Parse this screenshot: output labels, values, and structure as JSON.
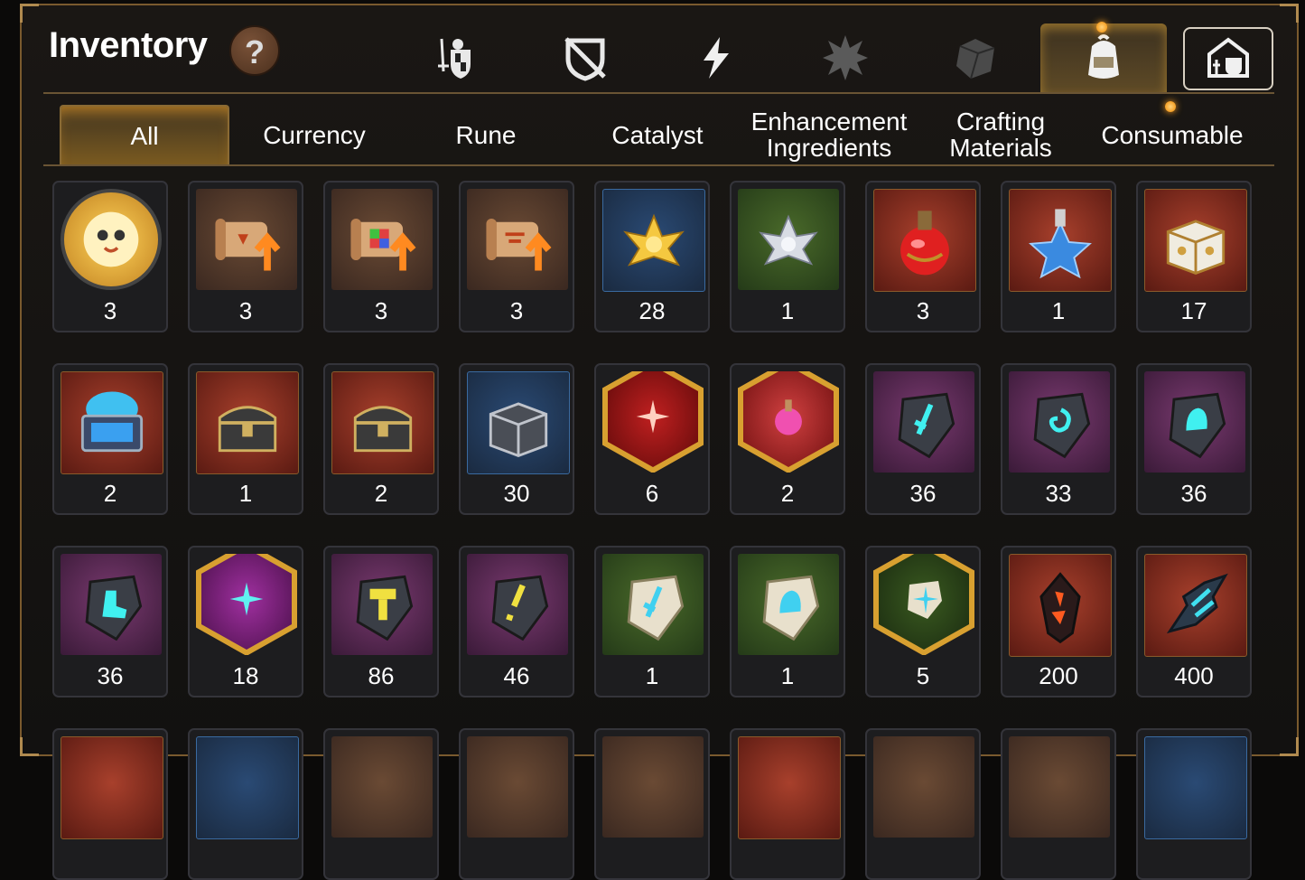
{
  "header": {
    "title": "Inventory",
    "help_glyph": "?"
  },
  "categories": [
    {
      "icon": "sword-shield-icon",
      "active": false
    },
    {
      "icon": "broken-shield-icon",
      "active": false
    },
    {
      "icon": "lightning-icon",
      "active": false
    },
    {
      "icon": "burst-icon",
      "active": false
    },
    {
      "icon": "cube-icon",
      "active": false
    },
    {
      "icon": "backpack-icon",
      "active": true,
      "notification": true
    },
    {
      "icon": "castle-icon",
      "active": false
    }
  ],
  "tabs": [
    {
      "label": "All",
      "active": true
    },
    {
      "label": "Currency",
      "active": false
    },
    {
      "label": "Rune",
      "active": false
    },
    {
      "label": "Catalyst",
      "active": false
    },
    {
      "label": "Enhancement Ingredients",
      "active": false
    },
    {
      "label": "Crafting Materials",
      "active": false
    },
    {
      "label": "Consumable",
      "active": false,
      "notification": true
    }
  ],
  "items": [
    [
      {
        "icon": "pet-medallion-icon",
        "qty": "3"
      },
      {
        "icon": "upgrade-scroll-icon",
        "qty": "3"
      },
      {
        "icon": "rainbow-scroll-icon",
        "qty": "3"
      },
      {
        "icon": "upgrade-scroll-icon",
        "qty": "3"
      },
      {
        "icon": "gold-lotus-icon",
        "qty": "28"
      },
      {
        "icon": "silver-lotus-icon",
        "qty": "1"
      },
      {
        "icon": "red-potion-icon",
        "qty": "3"
      },
      {
        "icon": "star-potion-icon",
        "qty": "1"
      },
      {
        "icon": "gold-box-icon",
        "qty": "17"
      }
    ],
    [
      {
        "icon": "blue-chest-icon",
        "qty": "2"
      },
      {
        "icon": "dark-chest-icon",
        "qty": "1"
      },
      {
        "icon": "dark-chest-icon",
        "qty": "2"
      },
      {
        "icon": "silver-box-icon",
        "qty": "30"
      },
      {
        "icon": "red-crest-stone-icon",
        "qty": "6"
      },
      {
        "icon": "pink-potion-icon",
        "qty": "2"
      },
      {
        "icon": "sword-rune-icon",
        "qty": "36"
      },
      {
        "icon": "spiral-rune-icon",
        "qty": "33"
      },
      {
        "icon": "bell-rune-icon",
        "qty": "36"
      }
    ],
    [
      {
        "icon": "boot-rune-icon",
        "qty": "36"
      },
      {
        "icon": "star-rune-icon",
        "qty": "18"
      },
      {
        "icon": "hammer-rune-icon",
        "qty": "86"
      },
      {
        "icon": "bolt-rune-icon",
        "qty": "46"
      },
      {
        "icon": "stone-sword-rune-icon",
        "qty": "1"
      },
      {
        "icon": "stone-bell-rune-icon",
        "qty": "1"
      },
      {
        "icon": "stone-star-rune-icon",
        "qty": "5"
      },
      {
        "icon": "ember-crystal-icon",
        "qty": "200"
      },
      {
        "icon": "azure-shard-icon",
        "qty": "400"
      }
    ]
  ]
}
